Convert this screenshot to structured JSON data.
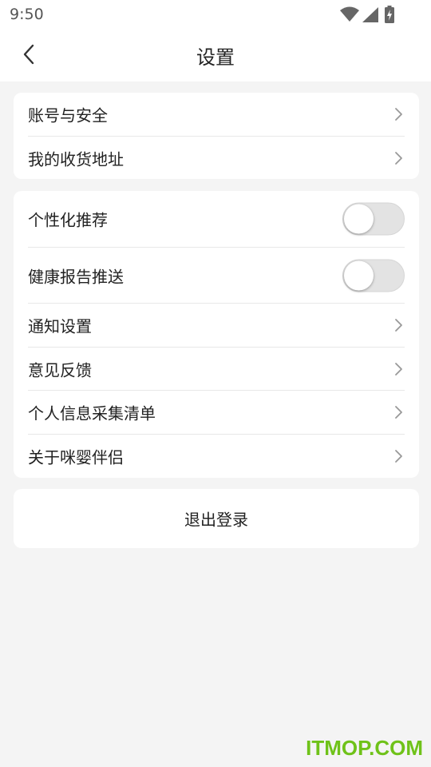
{
  "status_bar": {
    "time": "9:50",
    "icons": [
      "wifi-icon",
      "signal-icon",
      "battery-charging-icon"
    ]
  },
  "header": {
    "title": "设置",
    "back_icon": "chevron-left-icon"
  },
  "account_section": {
    "items": [
      {
        "label": "账号与安全",
        "icon": "chevron-right-icon"
      },
      {
        "label": "我的收货地址",
        "icon": "chevron-right-icon"
      }
    ]
  },
  "settings_section": {
    "toggles": [
      {
        "label": "个性化推荐",
        "state": "off"
      },
      {
        "label": "健康报告推送",
        "state": "off"
      }
    ],
    "items": [
      {
        "label": "通知设置",
        "icon": "chevron-right-icon"
      },
      {
        "label": "意见反馈",
        "icon": "chevron-right-icon"
      },
      {
        "label": "个人信息采集清单",
        "icon": "chevron-right-icon"
      },
      {
        "label": "关于咪婴伴侣",
        "icon": "chevron-right-icon"
      }
    ]
  },
  "logout": {
    "label": "退出登录"
  },
  "watermark": {
    "text": "ITMOP.COM",
    "color": "#6fc219"
  },
  "colors": {
    "background": "#f4f4f4",
    "card": "#ffffff",
    "divider": "#e8e8e8",
    "toggle_off": "#e3e3e3"
  }
}
